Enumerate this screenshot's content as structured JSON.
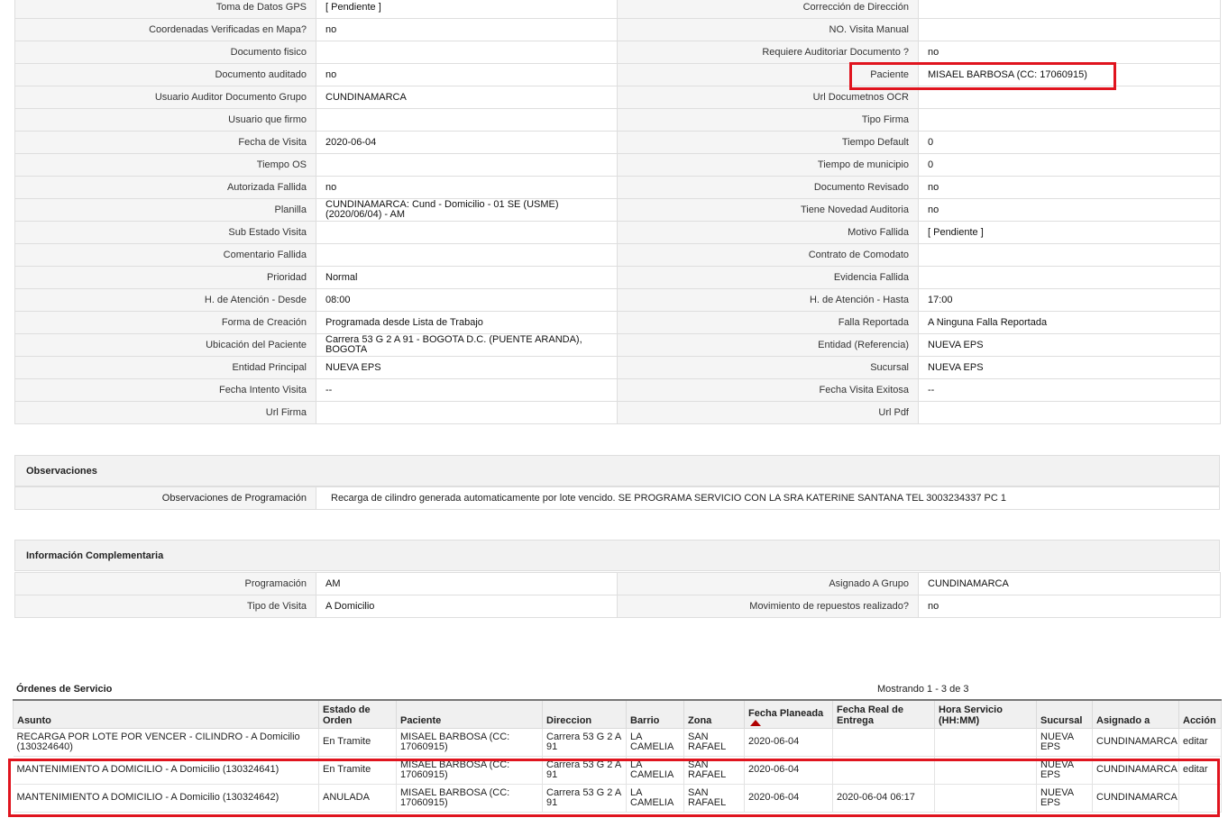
{
  "details": [
    {
      "l1": "Toma de Datos GPS",
      "v1": "[ Pendiente ]",
      "l2": "Corrección de Dirección",
      "v2": ""
    },
    {
      "l1": "Coordenadas Verificadas en Mapa?",
      "v1": " no",
      "l2": "NO. Visita Manual",
      "v2": ""
    },
    {
      "l1": "Documento fisico",
      "v1": "",
      "l2": "Requiere Auditoriar Documento ?",
      "v2": " no"
    },
    {
      "l1": "Documento auditado",
      "v1": " no",
      "l2": "Paciente",
      "v2": "MISAEL BARBOSA (CC: 17060915)"
    },
    {
      "l1": "Usuario Auditor Documento Grupo",
      "v1": "CUNDINAMARCA",
      "l2": "Url Documetnos OCR",
      "v2": ""
    },
    {
      "l1": "Usuario que firmo",
      "v1": "",
      "l2": "Tipo Firma",
      "v2": ""
    },
    {
      "l1": "Fecha de Visita",
      "v1": " 2020-06-04",
      "l2": "Tiempo Default",
      "v2": "0"
    },
    {
      "l1": "Tiempo OS",
      "v1": "",
      "l2": "Tiempo de municipio",
      "v2": "0"
    },
    {
      "l1": "Autorizada Fallida",
      "v1": " no",
      "l2": "Documento Revisado",
      "v2": " no"
    },
    {
      "l1": "Planilla",
      "v1": "CUNDINAMARCA: Cund - Domicilio - 01 SE (USME) (2020/06/04) - AM",
      "l2": "Tiene Novedad Auditoria",
      "v2": " no"
    },
    {
      "l1": "Sub Estado Visita",
      "v1": "",
      "l2": "Motivo Fallida",
      "v2": "[ Pendiente ]"
    },
    {
      "l1": "Comentario Fallida",
      "v1": "",
      "l2": "Contrato de Comodato",
      "v2": ""
    },
    {
      "l1": "Prioridad",
      "v1": "Normal",
      "l2": "Evidencia Fallida",
      "v2": ""
    },
    {
      "l1": "H. de Atención - Desde",
      "v1": "08:00",
      "l2": "H. de Atención - Hasta",
      "v2": "17:00"
    },
    {
      "l1": "Forma de Creación",
      "v1": "Programada desde Lista de Trabajo",
      "l2": "Falla Reportada",
      "v2": "A Ninguna Falla Reportada"
    },
    {
      "l1": "Ubicación del Paciente",
      "v1": "Carrera 53 G 2 A 91 - BOGOTA D.C. (PUENTE ARANDA), BOGOTA",
      "l2": "Entidad (Referencia)",
      "v2": "NUEVA EPS"
    },
    {
      "l1": "Entidad Principal",
      "v1": "NUEVA EPS",
      "l2": "Sucursal",
      "v2": "NUEVA EPS"
    },
    {
      "l1": "Fecha Intento Visita",
      "v1": " --",
      "l2": "Fecha Visita Exitosa",
      "v2": " --"
    },
    {
      "l1": "Url Firma",
      "v1": "",
      "l2": "Url Pdf",
      "v2": ""
    }
  ],
  "observaciones": {
    "title": "Observaciones",
    "label": "Observaciones de Programación",
    "value": "Recarga de cilindro generada automaticamente por lote vencido. SE PROGRAMA SERVICIO CON LA SRA KATERINE SANTANA TEL 3003234337 PC 1"
  },
  "complementaria": {
    "title": "Información Complementaria",
    "rows": [
      {
        "l1": "Programación",
        "v1": "AM",
        "l2": "Asignado A Grupo",
        "v2": "CUNDINAMARCA"
      },
      {
        "l1": "Tipo de Visita",
        "v1": "A Domicilio",
        "l2": "Movimiento de repuestos realizado?",
        "v2": " no"
      }
    ]
  },
  "orders": {
    "title": "Órdenes de Servicio",
    "count": "Mostrando 1 - 3 de 3",
    "headers": [
      "Asunto",
      "Estado de Orden",
      "Paciente",
      "Direccion",
      "Barrio",
      "Zona",
      "Fecha Planeada",
      "Fecha Real de Entrega",
      "Hora Servicio (HH:MM)",
      "Sucursal",
      "Asignado a",
      "Acción"
    ],
    "rows": [
      {
        "asunto": "RECARGA POR LOTE POR VENCER - CILINDRO - A Domicilio (130324640)",
        "estado": "En Tramite",
        "paciente": "MISAEL BARBOSA (CC: 17060915)",
        "direccion": "Carrera 53 G 2 A 91",
        "barrio": "LA CAMELIA",
        "zona": "SAN RAFAEL",
        "fecha_planeada": "2020-06-04",
        "fecha_real": "",
        "hora": "",
        "sucursal": "NUEVA EPS",
        "asignado": "CUNDINAMARCA",
        "accion": "editar"
      },
      {
        "asunto": "MANTENIMIENTO A DOMICILIO - A Domicilio (130324641)",
        "estado": "En Tramite",
        "paciente": "MISAEL BARBOSA (CC: 17060915)",
        "direccion": "Carrera 53 G 2 A 91",
        "barrio": "LA CAMELIA",
        "zona": "SAN RAFAEL",
        "fecha_planeada": "2020-06-04",
        "fecha_real": "",
        "hora": "",
        "sucursal": "NUEVA EPS",
        "asignado": "CUNDINAMARCA",
        "accion": "editar"
      },
      {
        "asunto": "MANTENIMIENTO A DOMICILIO - A Domicilio (130324642)",
        "estado": "ANULADA",
        "paciente": "MISAEL BARBOSA (CC: 17060915)",
        "direccion": "Carrera 53 G 2 A 91",
        "barrio": "LA CAMELIA",
        "zona": "SAN RAFAEL",
        "fecha_planeada": "2020-06-04",
        "fecha_real": "2020-06-04 06:17",
        "hora": "",
        "sucursal": "NUEVA EPS",
        "asignado": "CUNDINAMARCA",
        "accion": ""
      }
    ]
  },
  "colors": {
    "highlight": "#e0141e",
    "sort_arrow": "#b00000"
  }
}
